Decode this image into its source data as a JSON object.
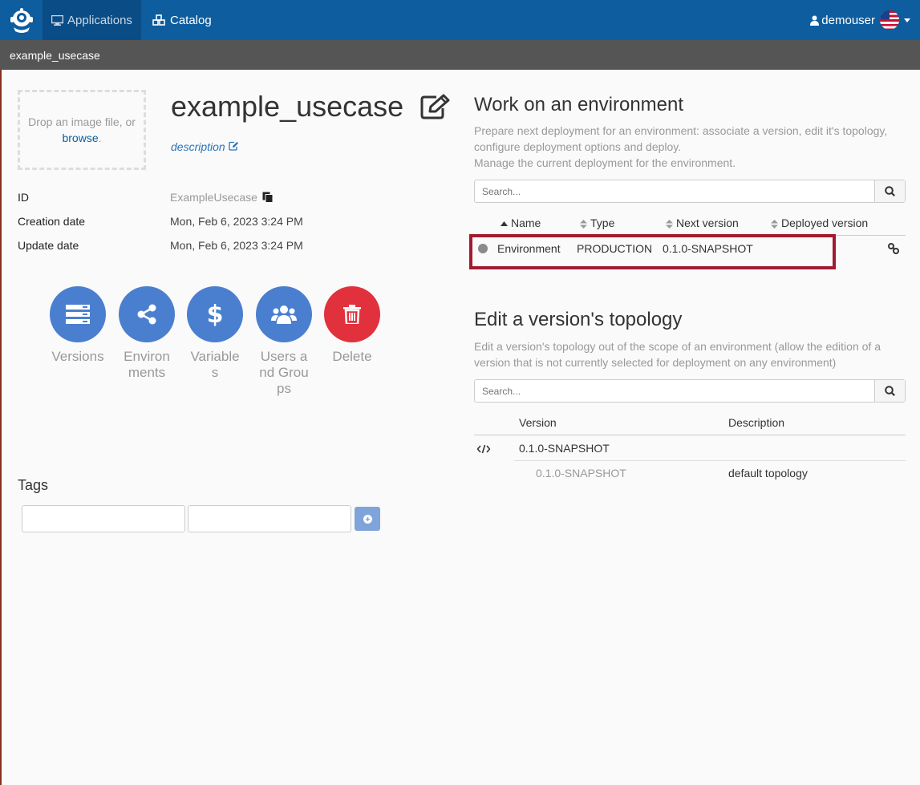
{
  "navbar": {
    "applications_label": "Applications",
    "catalog_label": "Catalog",
    "user_label": "demouser"
  },
  "breadcrumb": {
    "current": "example_usecase"
  },
  "app": {
    "name": "example_usecase",
    "description_label": "description",
    "dropzone_text": "Drop an image file, or",
    "dropzone_link": "browse",
    "dropzone_suffix": ".",
    "info": [
      {
        "label": "ID",
        "value": "ExampleUsecase"
      },
      {
        "label": "Creation date",
        "value": "Mon, Feb 6, 2023 3:24 PM"
      },
      {
        "label": "Update date",
        "value": "Mon, Feb 6, 2023 3:24 PM"
      }
    ]
  },
  "actions": [
    {
      "label": "Versions",
      "icon": "server-icon"
    },
    {
      "label": "Environments",
      "icon": "share-icon"
    },
    {
      "label": "Variables",
      "icon": "dollar-icon"
    },
    {
      "label": "Users and Groups",
      "icon": "users-icon"
    },
    {
      "label": "Delete",
      "icon": "trash-icon"
    }
  ],
  "tags": {
    "title": "Tags"
  },
  "environments": {
    "title": "Work on an environment",
    "desc1": "Prepare next deployment for an environment: associate a version, edit it's topology, configure deployment options and deploy.",
    "desc2": "Manage the current deployment for the environment.",
    "search_placeholder": "Search...",
    "columns": [
      "Name",
      "Type",
      "Next version",
      "Deployed version"
    ],
    "rows": [
      {
        "name": "Environment",
        "type": "PRODUCTION",
        "next_version": "0.1.0-SNAPSHOT",
        "deployed_version": ""
      }
    ]
  },
  "topology": {
    "title": "Edit a version's topology",
    "desc": "Edit a version's topology out of the scope of an environment (allow the edition of a version that is not currently selected for deployment on any environment)",
    "search_placeholder": "Search...",
    "columns": [
      "Version",
      "Description"
    ],
    "version": "0.1.0-SNAPSHOT",
    "sub_rows": [
      {
        "version": "0.1.0-SNAPSHOT",
        "description": "default topology"
      }
    ]
  },
  "colors": {
    "navbar": "#0e5d9e",
    "action_blue": "#4a7fd0",
    "action_red": "#e0313c",
    "highlight": "#a11b30"
  }
}
